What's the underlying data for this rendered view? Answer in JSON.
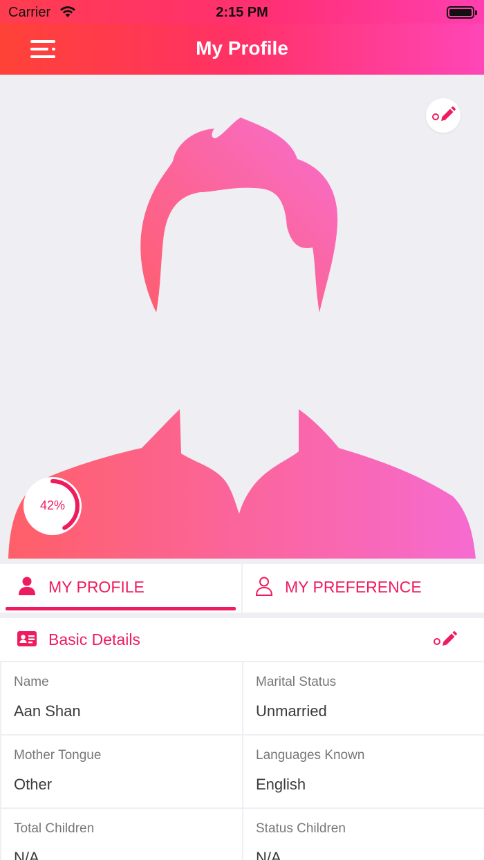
{
  "status_bar": {
    "carrier": "Carrier",
    "time": "2:15 PM"
  },
  "header": {
    "title": "My Profile",
    "menu_icon": "menu-icon"
  },
  "photo": {
    "edit_icon": "pencil-icon",
    "profile_completion": "42%",
    "profile_completion_fraction": 0.42
  },
  "tabs": [
    {
      "label": "MY PROFILE",
      "icon": "user-filled-icon",
      "selected": true
    },
    {
      "label": "MY PREFERENCE",
      "icon": "user-outline-icon",
      "selected": false
    }
  ],
  "basic_details": {
    "title": "Basic Details",
    "icon": "id-card-icon",
    "edit_icon": "pencil-icon",
    "fields": [
      {
        "label": "Name",
        "value": "Aan Shan"
      },
      {
        "label": "Marital Status",
        "value": "Unmarried"
      },
      {
        "label": "Mother Tongue",
        "value": "Other"
      },
      {
        "label": "Languages Known",
        "value": "English"
      },
      {
        "label": "Total Children",
        "value": "N/A"
      },
      {
        "label": "Status Children",
        "value": "N/A"
      }
    ]
  },
  "colors": {
    "accent": "#ee1c5f",
    "gradient_start": "#ff4237",
    "gradient_end": "#ff46b8"
  }
}
